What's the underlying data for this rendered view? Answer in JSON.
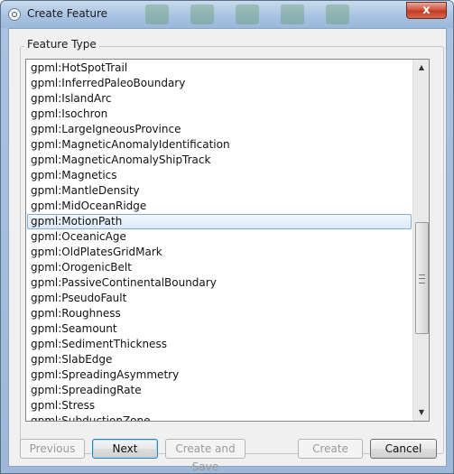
{
  "window": {
    "title": "Create Feature",
    "close_label": "x"
  },
  "group": {
    "title": "Feature Type"
  },
  "feature_list": {
    "selected_index": 10,
    "items": [
      {
        "label": "gpml:HotSpotTrail"
      },
      {
        "label": "gpml:InferredPaleoBoundary"
      },
      {
        "label": "gpml:IslandArc"
      },
      {
        "label": "gpml:Isochron"
      },
      {
        "label": "gpml:LargeIgneousProvince"
      },
      {
        "label": "gpml:MagneticAnomalyIdentification"
      },
      {
        "label": "gpml:MagneticAnomalyShipTrack"
      },
      {
        "label": "gpml:Magnetics"
      },
      {
        "label": "gpml:MantleDensity"
      },
      {
        "label": "gpml:MidOceanRidge"
      },
      {
        "label": "gpml:MotionPath"
      },
      {
        "label": "gpml:OceanicAge"
      },
      {
        "label": "gpml:OldPlatesGridMark"
      },
      {
        "label": "gpml:OrogenicBelt"
      },
      {
        "label": "gpml:PassiveContinentalBoundary"
      },
      {
        "label": "gpml:PseudoFault"
      },
      {
        "label": "gpml:Roughness"
      },
      {
        "label": "gpml:Seamount"
      },
      {
        "label": "gpml:SedimentThickness"
      },
      {
        "label": "gpml:SlabEdge"
      },
      {
        "label": "gpml:SpreadingAsymmetry"
      },
      {
        "label": "gpml:SpreadingRate"
      },
      {
        "label": "gpml:Stress"
      },
      {
        "label": "gpml:SubductionZone"
      }
    ]
  },
  "buttons": {
    "previous": "Previous",
    "next": "Next",
    "create_and_save": "Create and Save",
    "create": "Create",
    "cancel": "Cancel"
  }
}
